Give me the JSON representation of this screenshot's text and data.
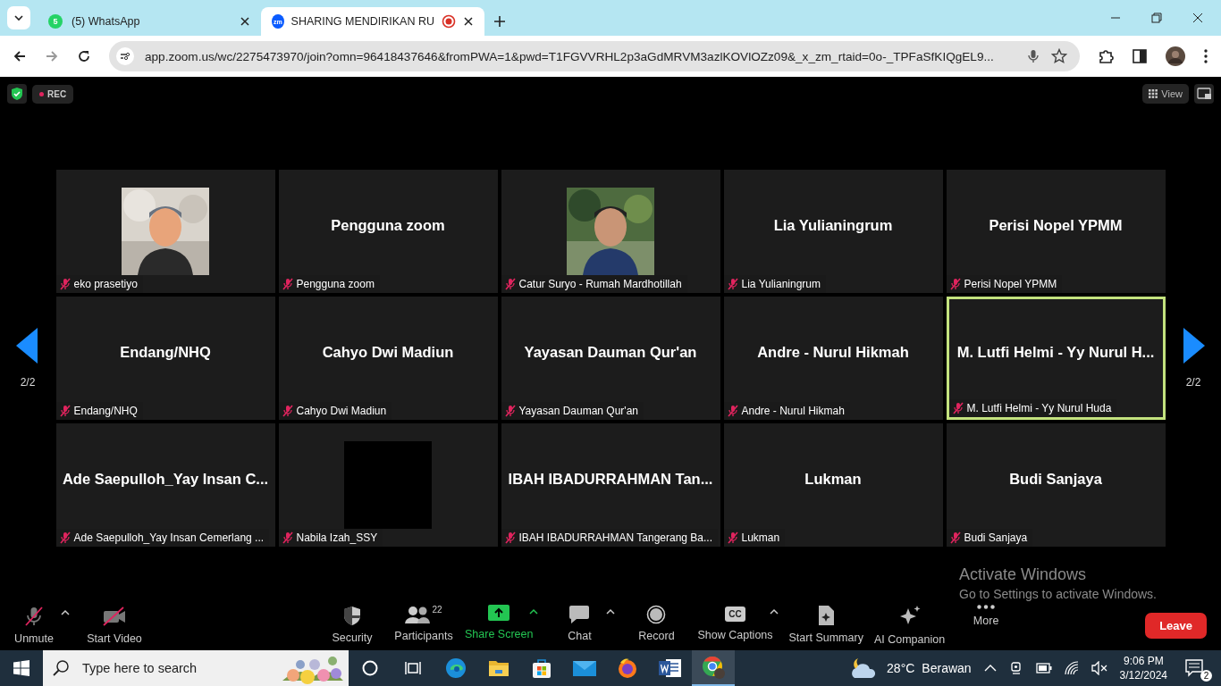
{
  "browser": {
    "tabs": [
      {
        "title": "(5) WhatsApp",
        "kind": "whatsapp",
        "icon_count": "5",
        "recording": false,
        "selected": false
      },
      {
        "title": "SHARING MENDIRIKAN RU",
        "kind": "zoom",
        "icon_count": "zm",
        "recording": true,
        "selected": true
      }
    ],
    "url": "app.zoom.us/wc/2275473970/join?omn=96418437646&fromPWA=1&pwd=T1FGVVRHL2p3aGdMRVM3azlKOVlOZz09&_x_zm_rtaid=0o-_TPFaSfKIQgEL9..."
  },
  "meeting": {
    "rec_label": "REC",
    "view_label": "View",
    "page_left": "2/2",
    "page_right": "2/2",
    "tiles": [
      {
        "kind": "picture",
        "label": "eko prasetiyo",
        "muted": true,
        "selected": false
      },
      {
        "kind": "name",
        "display_name": "Pengguna zoom",
        "label": "Pengguna zoom",
        "muted": true,
        "selected": false
      },
      {
        "kind": "picture",
        "label": "Catur Suryo - Rumah Mardhotillah",
        "muted": true,
        "selected": false
      },
      {
        "kind": "name",
        "display_name": "Lia Yulianingrum",
        "label": "Lia Yulianingrum",
        "muted": true,
        "selected": false
      },
      {
        "kind": "name",
        "display_name": "Perisi Nopel YPMM",
        "label": "Perisi Nopel YPMM",
        "muted": true,
        "selected": false
      },
      {
        "kind": "name",
        "display_name": "Endang/NHQ",
        "label": "Endang/NHQ",
        "muted": true,
        "selected": false
      },
      {
        "kind": "name",
        "display_name": "Cahyo Dwi Madiun",
        "label": "Cahyo Dwi Madiun",
        "muted": true,
        "selected": false
      },
      {
        "kind": "name",
        "display_name": "Yayasan Dauman Qur'an",
        "label": "Yayasan Dauman Qur'an",
        "muted": true,
        "selected": false
      },
      {
        "kind": "name",
        "display_name": "Andre - Nurul Hikmah",
        "label": "Andre - Nurul Hikmah",
        "muted": true,
        "selected": false
      },
      {
        "kind": "name",
        "display_name": "M. Lutfi Helmi - Yy Nurul H...",
        "label": "M. Lutfi Helmi - Yy Nurul Huda",
        "muted": true,
        "selected": true
      },
      {
        "kind": "name",
        "display_name": "Ade Saepulloh_Yay Insan C...",
        "label": "Ade Saepulloh_Yay Insan Cemerlang ...",
        "muted": true,
        "selected": false
      },
      {
        "kind": "blank",
        "label": "Nabila Izah_SSY",
        "muted": true,
        "selected": false
      },
      {
        "kind": "name",
        "display_name": "IBAH IBADURRAHMAN Tan...",
        "label": "IBAH IBADURRAHMAN Tangerang Ba...",
        "muted": true,
        "selected": false
      },
      {
        "kind": "name",
        "display_name": "Lukman",
        "label": "Lukman",
        "muted": true,
        "selected": false
      },
      {
        "kind": "name",
        "display_name": "Budi Sanjaya",
        "label": "Budi Sanjaya",
        "muted": true,
        "selected": false
      }
    ],
    "toolbar_left": [
      {
        "kind": "mic",
        "label": "Unmute",
        "caret": true,
        "highlighted": false
      },
      {
        "kind": "video",
        "label": "Start Video",
        "caret": false,
        "highlighted": false
      }
    ],
    "toolbar": [
      {
        "kind": "shield",
        "label": "Security",
        "caret": false,
        "highlighted": false
      },
      {
        "kind": "people",
        "label": "Participants",
        "count": "22",
        "caret": false,
        "highlighted": false
      },
      {
        "kind": "share",
        "label": "Share Screen",
        "caret": true,
        "highlighted": true
      },
      {
        "kind": "chat",
        "label": "Chat",
        "caret": true,
        "highlighted": false
      },
      {
        "kind": "record",
        "label": "Record",
        "caret": false,
        "highlighted": false
      },
      {
        "kind": "cc",
        "label": "Show Captions",
        "icon_text": "CC",
        "caret": true,
        "highlighted": false
      },
      {
        "kind": "summary",
        "label": "Start Summary",
        "caret": false,
        "highlighted": false
      },
      {
        "kind": "sparkle",
        "label": "AI Companion",
        "caret": false,
        "highlighted": false
      },
      {
        "kind": "more",
        "label": "More",
        "caret": false,
        "highlighted": false
      }
    ],
    "leave": "Leave"
  },
  "activation": {
    "title": "Activate Windows",
    "subtitle": "Go to Settings to activate Windows."
  },
  "taskbar": {
    "search_placeholder": "Type here to search",
    "apps": [
      {
        "kind": "cortana",
        "selected": false
      },
      {
        "kind": "taskview",
        "selected": false
      },
      {
        "kind": "edge",
        "selected": false
      },
      {
        "kind": "folder",
        "selected": false
      },
      {
        "kind": "store",
        "selected": false
      },
      {
        "kind": "mail",
        "selected": false
      },
      {
        "kind": "firefox",
        "selected": false
      },
      {
        "kind": "word",
        "selected": false
      },
      {
        "kind": "chrome",
        "selected": true
      }
    ],
    "temperature": "28°C",
    "weather": "Berawan",
    "time": "9:06 PM",
    "date": "3/12/2024",
    "notifications": "2"
  }
}
